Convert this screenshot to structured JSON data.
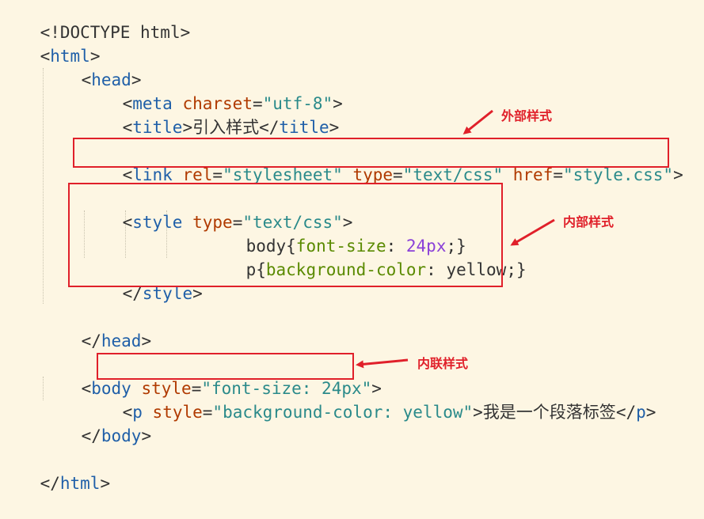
{
  "code": {
    "doctype": "<!DOCTYPE html>",
    "html_open_lt": "<",
    "html_open_tag": "html",
    "html_open_gt": ">",
    "head_open_lt": "<",
    "head_open_tag": "head",
    "head_open_gt": ">",
    "meta_lt": "<",
    "meta_tag": "meta",
    "meta_sp": " ",
    "meta_attr": "charset",
    "meta_eq": "=",
    "meta_val": "\"utf-8\"",
    "meta_gt": ">",
    "title_lt": "<",
    "title_tag": "title",
    "title_gt": ">",
    "title_text": "引入样式",
    "title_close_lt": "</",
    "title_close_tag": "title",
    "title_close_gt": ">",
    "link_lt": "<",
    "link_tag": "link",
    "link_sp1": " ",
    "link_attr1": "rel",
    "link_eq1": "=",
    "link_val1": "\"stylesheet\"",
    "link_sp2": " ",
    "link_attr2": "type",
    "link_eq2": "=",
    "link_val2": "\"text/css\"",
    "link_sp3": " ",
    "link_attr3": "href",
    "link_eq3": "=",
    "link_val3": "\"style.css\"",
    "link_gt": ">",
    "style_lt": "<",
    "style_tag": "style",
    "style_sp": " ",
    "style_attr": "type",
    "style_eq": "=",
    "style_val": "\"text/css\"",
    "style_gt": ">",
    "css1_sel": "body{",
    "css1_prop": "font-size",
    "css1_colon": ": ",
    "css1_val": "24px",
    "css1_end": ";}",
    "css2_sel": "p{",
    "css2_prop": "background-color",
    "css2_colon": ": ",
    "css2_val": "yellow;}",
    "style_close_lt": "</",
    "style_close_tag": "style",
    "style_close_gt": ">",
    "head_close_lt": "</",
    "head_close_tag": "head",
    "head_close_gt": ">",
    "body_lt": "<",
    "body_tag": "body",
    "body_sp": " ",
    "body_attr": "style",
    "body_eq": "=",
    "body_val": "\"font-size: 24px\"",
    "body_gt": ">",
    "p_lt": "<",
    "p_tag": "p",
    "p_sp": " ",
    "p_attr": "style",
    "p_eq": "=",
    "p_val": "\"background-color: yellow\"",
    "p_gt": ">",
    "p_text": "我是一个段落标签",
    "p_close_lt": "</",
    "p_close_tag": "p",
    "p_close_gt": ">",
    "body_close_lt": "</",
    "body_close_tag": "body",
    "body_close_gt": ">",
    "html_close_lt": "</",
    "html_close_tag": "html",
    "html_close_gt": ">"
  },
  "annotations": {
    "external": "外部样式",
    "internal": "内部样式",
    "inline": "内联样式"
  },
  "colors": {
    "background": "#fdf6e3",
    "tag": "#1f5fa8",
    "attribute": "#b03a00",
    "string": "#2a8a8a",
    "number": "#8a40d8",
    "property": "#5a8a00",
    "highlight": "#e0202a"
  }
}
